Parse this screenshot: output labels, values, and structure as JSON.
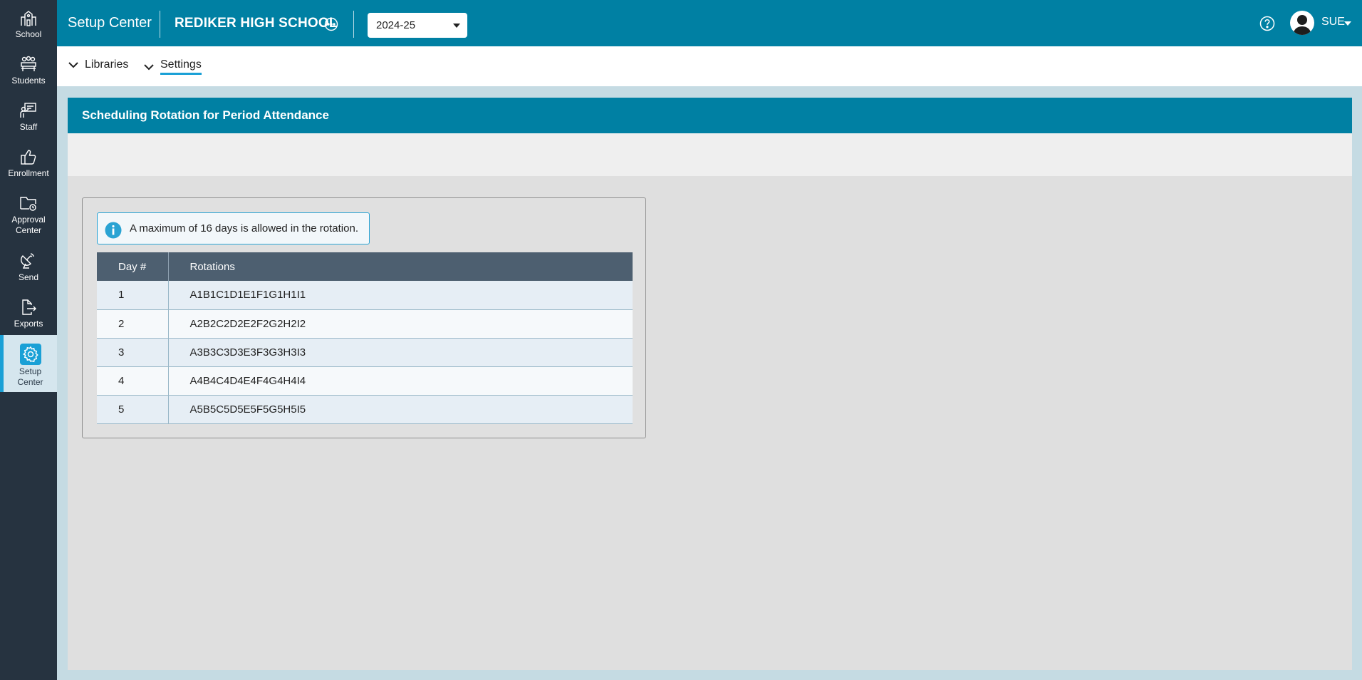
{
  "nav": {
    "items": [
      {
        "label": "School",
        "icon": "school-icon"
      },
      {
        "label": "Students",
        "icon": "students-icon"
      },
      {
        "label": "Staff",
        "icon": "staff-icon"
      },
      {
        "label": "Enrollment",
        "icon": "thumbs-up-icon"
      },
      {
        "label": "Approval Center",
        "icon": "folder-approval-icon"
      },
      {
        "label": "Send",
        "icon": "satellite-dish-icon"
      },
      {
        "label": "Exports",
        "icon": "file-export-icon"
      },
      {
        "label": "Setup Center",
        "icon": "gear-icon",
        "active": true
      }
    ]
  },
  "header": {
    "app_title": "Setup Center",
    "school_name": "REDIKER HIGH SCHOOL",
    "school_year": "2024-25",
    "user_name": "SUE"
  },
  "subnav": {
    "libraries": "Libraries",
    "settings": "Settings",
    "active": "Settings"
  },
  "panel": {
    "title": "Scheduling Rotation for Period Attendance",
    "info_message": "A maximum of 16 days is allowed in the rotation.",
    "table": {
      "headers": [
        "Day #",
        "Rotations"
      ],
      "rows": [
        [
          "1",
          "A1B1C1D1E1F1G1H1I1"
        ],
        [
          "2",
          "A2B2C2D2E2F2G2H2I2"
        ],
        [
          "3",
          "A3B3C3D3E3F3G3H3I3"
        ],
        [
          "4",
          "A4B4C4D4E4F4G4H4I4"
        ],
        [
          "5",
          "A5B5C5D5E5F5G5H5I5"
        ]
      ]
    }
  },
  "colors": {
    "brand": "#0080a3",
    "nav_bg": "#263340",
    "accent": "#1aa0d6",
    "table_header": "#4d5f70"
  }
}
